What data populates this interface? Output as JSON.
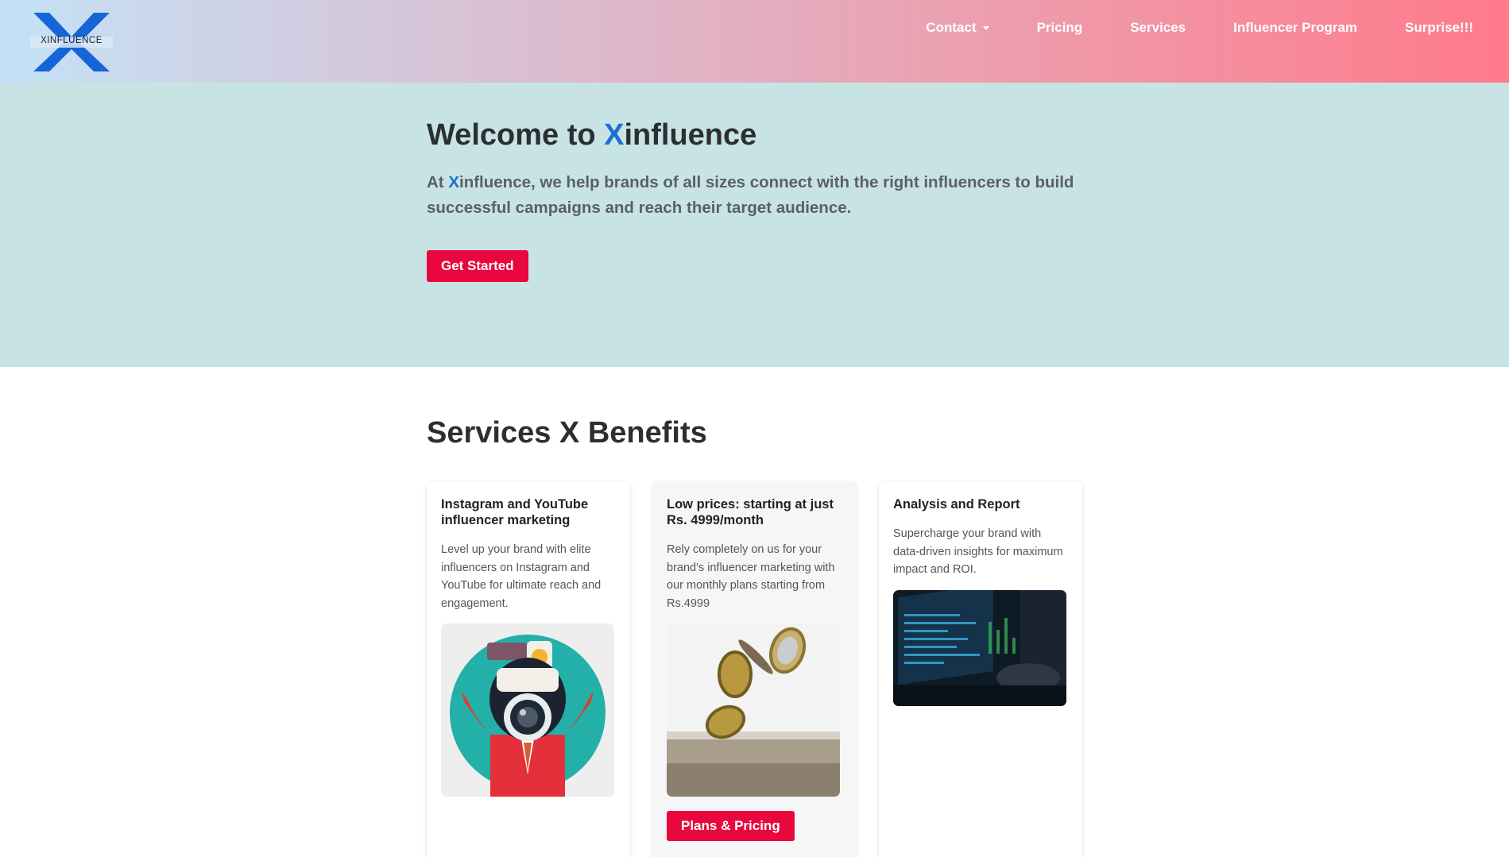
{
  "brand": {
    "logo_text": "XINFLUENCE",
    "accent_color": "#1b6fd1",
    "cta_color": "#e8083e"
  },
  "nav": {
    "items": [
      {
        "label": "Contact",
        "has_dropdown": true
      },
      {
        "label": "Pricing"
      },
      {
        "label": "Services"
      },
      {
        "label": "Influencer Program"
      },
      {
        "label": "Surprise!!!"
      }
    ]
  },
  "hero": {
    "title_prefix": "Welcome to ",
    "title_accent": "X",
    "title_suffix": "influence",
    "desc_prefix": "At ",
    "desc_accent": "X",
    "desc_suffix": "influence, we help brands of all sizes connect with the right influencers to build successful campaigns and reach their target audience.",
    "cta_label": "Get Started"
  },
  "services": {
    "title": "Services X Benefits",
    "cards": [
      {
        "title": "Instagram and YouTube influencer marketing",
        "description": "Level up your brand with elite influencers on Instagram and YouTube for ultimate reach and engagement.",
        "image_icon": "camera-character-illustration"
      },
      {
        "title": "Low prices: starting at just Rs. 4999/month",
        "description": "Rely completely on us for your brand's influencer marketing with our monthly plans starting from Rs.4999",
        "image_icon": "falling-coins-photo",
        "button_label": "Plans & Pricing"
      },
      {
        "title": "Analysis and Report",
        "description": "Supercharge your brand with data-driven insights for maximum impact and ROI.",
        "image_icon": "data-screen-photo"
      }
    ]
  }
}
